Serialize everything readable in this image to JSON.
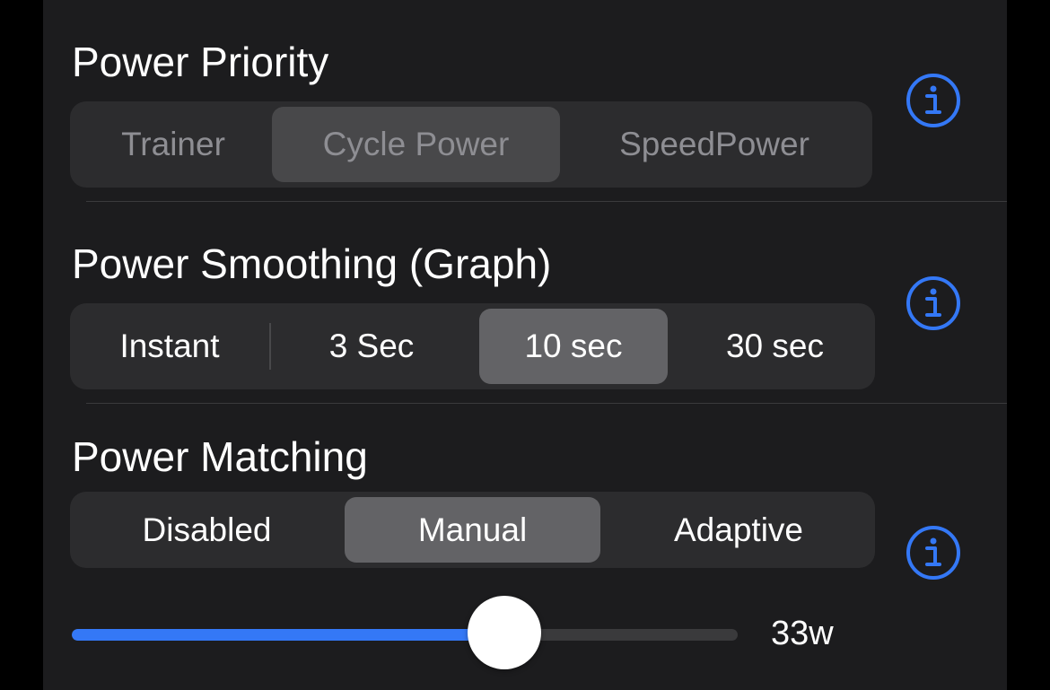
{
  "colors": {
    "background": "#1c1c1e",
    "segment_bg": "#2c2c2e",
    "segment_selected": "#636366",
    "accent": "#3478f6",
    "text": "#ffffff",
    "text_disabled": "#8e8e93"
  },
  "power_priority": {
    "title": "Power Priority",
    "options": [
      "Trainer",
      "Cycle Power",
      "SpeedPower"
    ],
    "selected": "Cycle Power",
    "enabled": false,
    "info_icon": "info-circle-icon"
  },
  "power_smoothing": {
    "title": "Power Smoothing (Graph)",
    "options": [
      "Instant",
      "3 Sec",
      "10 sec",
      "30 sec"
    ],
    "selected": "10 sec",
    "enabled": true,
    "info_icon": "info-circle-icon"
  },
  "power_matching": {
    "title": "Power Matching",
    "options": [
      "Disabled",
      "Manual",
      "Adaptive"
    ],
    "selected": "Manual",
    "enabled": true,
    "info_icon": "info-circle-icon",
    "slider": {
      "value_label": "33w",
      "fraction": 0.65
    }
  }
}
